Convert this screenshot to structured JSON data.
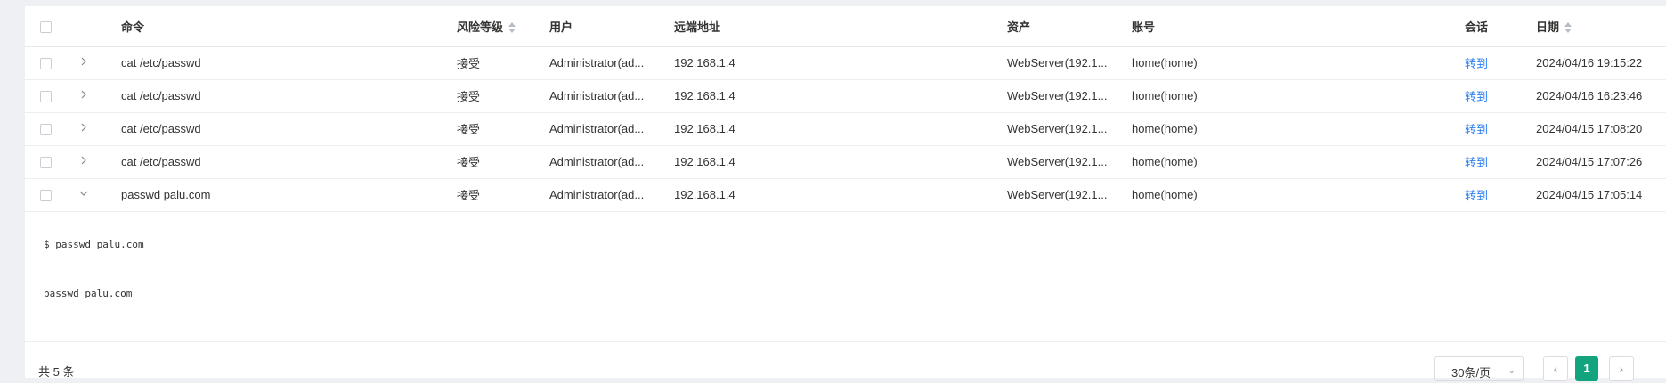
{
  "table": {
    "headers": {
      "command": "命令",
      "risk": "风险等级",
      "user": "用户",
      "remote": "远端地址",
      "asset": "资产",
      "account": "账号",
      "session": "会话",
      "date": "日期"
    },
    "rows": [
      {
        "command": "cat /etc/passwd",
        "risk": "接受",
        "user": "Administrator(ad...",
        "remote": "192.168.1.4",
        "asset": "WebServer(192.1...",
        "account": "home(home)",
        "session": "转到",
        "date": "2024/04/16 19:15:22"
      },
      {
        "command": "cat /etc/passwd",
        "risk": "接受",
        "user": "Administrator(ad...",
        "remote": "192.168.1.4",
        "asset": "WebServer(192.1...",
        "account": "home(home)",
        "session": "转到",
        "date": "2024/04/16 16:23:46"
      },
      {
        "command": "cat /etc/passwd",
        "risk": "接受",
        "user": "Administrator(ad...",
        "remote": "192.168.1.4",
        "asset": "WebServer(192.1...",
        "account": "home(home)",
        "session": "转到",
        "date": "2024/04/15 17:08:20"
      },
      {
        "command": "cat /etc/passwd",
        "risk": "接受",
        "user": "Administrator(ad...",
        "remote": "192.168.1.4",
        "asset": "WebServer(192.1...",
        "account": "home(home)",
        "session": "转到",
        "date": "2024/04/15 17:07:26"
      },
      {
        "command": "passwd palu.com",
        "risk": "接受",
        "user": "Administrator(ad...",
        "remote": "192.168.1.4",
        "asset": "WebServer(192.1...",
        "account": "home(home)",
        "session": "转到",
        "date": "2024/04/15 17:05:14"
      }
    ],
    "expanded": {
      "line1": "$ passwd palu.com",
      "line2": "passwd palu.com"
    }
  },
  "footer": {
    "total": "共 5 条",
    "page_size": "30条/页",
    "current_page": "1",
    "prev_icon": "chevron-left-icon",
    "next_icon": "chevron-right-icon"
  },
  "colors": {
    "link": "#2d7ff0",
    "accent": "#14a37f"
  }
}
